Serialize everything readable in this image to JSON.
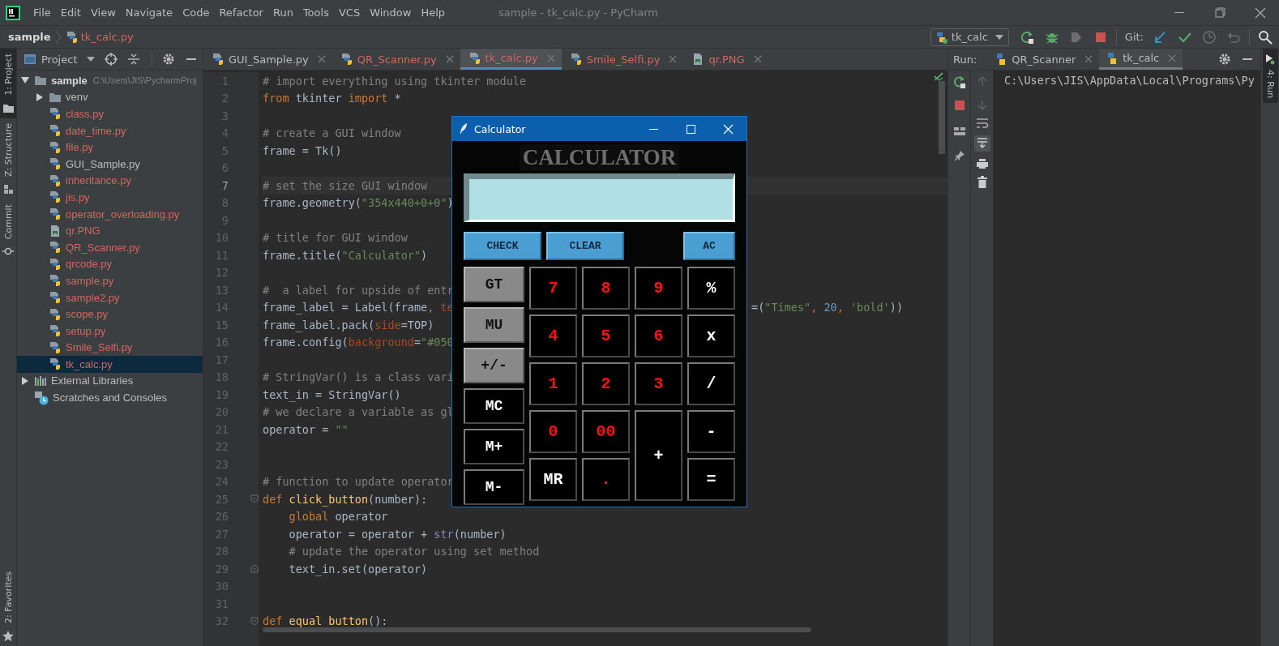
{
  "menu_bar": {
    "items": [
      "File",
      "Edit",
      "View",
      "Navigate",
      "Code",
      "Refactor",
      "Run",
      "Tools",
      "VCS",
      "Window",
      "Help"
    ],
    "title": "sample - tk_calc.py - PyCharm"
  },
  "navigation_bar": {
    "breadcrumbs": [
      {
        "label": "sample",
        "kind": "folder",
        "color": "#d8d8d8"
      },
      {
        "label": "tk_calc.py",
        "kind": "python",
        "color": "#d2665f"
      }
    ],
    "run_config": "tk_calc",
    "git_label": "Git:"
  },
  "left_stripe": {
    "tabs": [
      {
        "label": "1: Project",
        "kind": "project",
        "selected": true
      },
      {
        "label": "Z: Structure",
        "kind": "structure",
        "selected": false
      },
      {
        "label": "Commit",
        "kind": "commit",
        "selected": false
      }
    ],
    "bottom_tabs": [
      {
        "label": "2: Favorites",
        "kind": "favorites",
        "selected": false
      }
    ]
  },
  "project_panel": {
    "title": "Project",
    "tree": [
      {
        "label": "sample",
        "path": "C:\\Users\\JIS\\PycharmProj",
        "kind": "folder",
        "color": "#d8d8d8",
        "expanded": true,
        "selected": false,
        "children": [
          {
            "label": "venv",
            "kind": "folder",
            "color": "#bbbbbb",
            "expanded": false,
            "selected": false
          },
          {
            "label": "class.py",
            "kind": "python",
            "color": "#d2665f",
            "selected": false
          },
          {
            "label": "date_time.py",
            "kind": "python",
            "color": "#d2665f",
            "selected": false
          },
          {
            "label": "file.py",
            "kind": "python",
            "color": "#d2665f",
            "selected": false
          },
          {
            "label": "GUI_Sample.py",
            "kind": "python",
            "color": "#bbbbbb",
            "selected": false
          },
          {
            "label": "inheritance.py",
            "kind": "python",
            "color": "#d2665f",
            "selected": false
          },
          {
            "label": "jis.py",
            "kind": "python",
            "color": "#d2665f",
            "selected": false
          },
          {
            "label": "operator_overloading.py",
            "kind": "python",
            "color": "#d2665f",
            "selected": false
          },
          {
            "label": "qr.PNG",
            "kind": "image",
            "color": "#d2665f",
            "selected": false
          },
          {
            "label": "QR_Scanner.py",
            "kind": "python",
            "color": "#d2665f",
            "selected": false
          },
          {
            "label": "qrcode.py",
            "kind": "python",
            "color": "#d2665f",
            "selected": false
          },
          {
            "label": "sample.py",
            "kind": "python",
            "color": "#d2665f",
            "selected": false
          },
          {
            "label": "sample2.py",
            "kind": "python",
            "color": "#d2665f",
            "selected": false
          },
          {
            "label": "scope.py",
            "kind": "python",
            "color": "#d2665f",
            "selected": false
          },
          {
            "label": "setup.py",
            "kind": "python",
            "color": "#d2665f",
            "selected": false
          },
          {
            "label": "Smile_Selfi.py",
            "kind": "python",
            "color": "#d2665f",
            "selected": false
          },
          {
            "label": "tk_calc.py",
            "kind": "python",
            "color": "#d2665f",
            "selected": true
          }
        ]
      },
      {
        "label": "External Libraries",
        "kind": "library",
        "color": "#bbbbbb",
        "expanded": false,
        "selected": false
      },
      {
        "label": "Scratches and Consoles",
        "kind": "scratch",
        "color": "#bbbbbb",
        "selected": false
      }
    ]
  },
  "editor": {
    "tabs": [
      {
        "label": "GUI_Sample.py",
        "kind": "python",
        "color": "#bbbbbb",
        "selected": false
      },
      {
        "label": "QR_Scanner.py",
        "kind": "python",
        "color": "#d2665f",
        "selected": false
      },
      {
        "label": "tk_calc.py",
        "kind": "python",
        "color": "#d2665f",
        "selected": true
      },
      {
        "label": "Smile_Selfi.py",
        "kind": "python",
        "color": "#d2665f",
        "selected": false
      },
      {
        "label": "qr.PNG",
        "kind": "image",
        "color": "#d2665f",
        "selected": false
      }
    ],
    "lines": [
      {
        "number": "1",
        "current": false,
        "left": [
          {
            "kind": "comment",
            "text": "# import everything using tkinter module"
          }
        ]
      },
      {
        "number": "2",
        "current": false,
        "left": [
          {
            "kind": "keyword",
            "text": "from"
          },
          {
            "kind": "plain",
            "text": " tkinter "
          },
          {
            "kind": "keyword",
            "text": "import"
          },
          {
            "kind": "plain",
            "text": " *"
          }
        ]
      },
      {
        "number": "3",
        "current": false
      },
      {
        "number": "4",
        "current": false,
        "left": [
          {
            "kind": "comment",
            "text": "# create a GUI window"
          }
        ]
      },
      {
        "number": "5",
        "current": false,
        "left": [
          {
            "kind": "plain",
            "text": "frame = Tk()"
          }
        ]
      },
      {
        "number": "6",
        "current": false
      },
      {
        "number": "7",
        "current": true,
        "left": [
          {
            "kind": "comment",
            "text": "# set the size GUI window"
          }
        ]
      },
      {
        "number": "8",
        "current": false,
        "left": [
          {
            "kind": "plain",
            "text": "frame.geometry("
          },
          {
            "kind": "string",
            "text": "\"354x440+0+0\""
          },
          {
            "kind": "plain",
            "text": ")"
          }
        ]
      },
      {
        "number": "9",
        "current": false
      },
      {
        "number": "10",
        "current": false,
        "left": [
          {
            "kind": "comment",
            "text": "# title for GUI window"
          }
        ]
      },
      {
        "number": "11",
        "current": false,
        "left": [
          {
            "kind": "plain",
            "text": "frame.title("
          },
          {
            "kind": "string",
            "text": "\"Calculator\""
          },
          {
            "kind": "plain",
            "text": ")"
          }
        ]
      },
      {
        "number": "12",
        "current": false
      },
      {
        "number": "13",
        "current": false,
        "left": [
          {
            "kind": "comment",
            "text": "#  a label for upside of entr"
          }
        ]
      },
      {
        "number": "14",
        "current": false,
        "left": [
          {
            "kind": "plain",
            "text": "frame_label = Label(frame"
          },
          {
            "kind": "keyword",
            "text": ", "
          },
          {
            "kind": "kwarg",
            "text": "te"
          }
        ],
        "right": [
          {
            "kind": "plain",
            "text": "=("
          },
          {
            "kind": "string",
            "text": "\"Times\""
          },
          {
            "kind": "keyword",
            "text": ", "
          },
          {
            "kind": "number",
            "text": "20"
          },
          {
            "kind": "keyword",
            "text": ", "
          },
          {
            "kind": "string",
            "text": "'bold'"
          },
          {
            "kind": "plain",
            "text": "))"
          }
        ]
      },
      {
        "number": "15",
        "current": false,
        "left": [
          {
            "kind": "plain",
            "text": "frame_label.pack("
          },
          {
            "kind": "kwarg",
            "text": "side"
          },
          {
            "kind": "plain",
            "text": "=TOP)"
          }
        ]
      },
      {
        "number": "16",
        "current": false,
        "left": [
          {
            "kind": "plain",
            "text": "frame.config("
          },
          {
            "kind": "kwarg",
            "text": "background"
          },
          {
            "kind": "plain",
            "text": "="
          },
          {
            "kind": "string",
            "text": "\"#050"
          }
        ]
      },
      {
        "number": "17",
        "current": false
      },
      {
        "number": "18",
        "current": false,
        "left": [
          {
            "kind": "comment",
            "text": "# StringVar() is a class vari"
          }
        ]
      },
      {
        "number": "19",
        "current": false,
        "left": [
          {
            "kind": "plain",
            "text": "text_in = StringVar()"
          }
        ]
      },
      {
        "number": "20",
        "current": false,
        "left": [
          {
            "kind": "comment",
            "text": "# we declare a variable as gl"
          }
        ]
      },
      {
        "number": "21",
        "current": false,
        "left": [
          {
            "kind": "plain",
            "text": "operator = "
          },
          {
            "kind": "string",
            "text": "\"\""
          }
        ]
      },
      {
        "number": "22",
        "current": false
      },
      {
        "number": "23",
        "current": false
      },
      {
        "number": "24",
        "current": false,
        "left": [
          {
            "kind": "comment",
            "text": "# function to update operator"
          }
        ]
      },
      {
        "number": "25",
        "current": false,
        "fold_open": true,
        "left": [
          {
            "kind": "keyword",
            "text": "def "
          },
          {
            "kind": "function",
            "text": "click_button"
          },
          {
            "kind": "plain",
            "text": "(number):"
          }
        ]
      },
      {
        "number": "26",
        "current": false,
        "left": [
          {
            "kind": "keyword",
            "text": "    global"
          },
          {
            "kind": "plain",
            "text": " operator"
          }
        ]
      },
      {
        "number": "27",
        "current": false,
        "left": [
          {
            "kind": "plain",
            "text": "    operator = operator + "
          },
          {
            "kind": "builtin",
            "text": "str"
          },
          {
            "kind": "plain",
            "text": "(number)"
          }
        ]
      },
      {
        "number": "28",
        "current": false,
        "left": [
          {
            "kind": "comment",
            "text": "    # update the operator using set method"
          }
        ]
      },
      {
        "number": "29",
        "current": false,
        "fold_close": true,
        "left": [
          {
            "kind": "plain",
            "text": "    text_in.set(operator)"
          }
        ]
      },
      {
        "number": "30",
        "current": false
      },
      {
        "number": "31",
        "current": false
      },
      {
        "number": "32",
        "current": false,
        "fold_open": true,
        "left": [
          {
            "kind": "keyword",
            "text": "def "
          },
          {
            "kind": "function",
            "text": "equal_button"
          },
          {
            "kind": "plain",
            "text": "():"
          }
        ]
      }
    ]
  },
  "calculator": {
    "title": "Calculator",
    "heading": "CALCULATOR",
    "top_buttons": [
      {
        "label": "CHECK"
      },
      {
        "label": "CLEAR"
      },
      {
        "label": "AC"
      }
    ],
    "side_buttons": [
      {
        "label": "GT",
        "kind": "function"
      },
      {
        "label": "MU",
        "kind": "function"
      },
      {
        "label": "+/-",
        "kind": "function"
      },
      {
        "label": "MC",
        "kind": "memory"
      },
      {
        "label": "M+",
        "kind": "memory"
      },
      {
        "label": "M-",
        "kind": "memory"
      }
    ],
    "keypad": [
      {
        "label": "7",
        "kind": "digit",
        "tall": false
      },
      {
        "label": "4",
        "kind": "digit",
        "tall": false
      },
      {
        "label": "1",
        "kind": "digit",
        "tall": false
      },
      {
        "label": "0",
        "kind": "digit",
        "tall": false
      },
      {
        "label": "MR",
        "kind": "memory",
        "tall": false
      },
      {
        "label": "8",
        "kind": "digit",
        "tall": false
      },
      {
        "label": "5",
        "kind": "digit",
        "tall": false
      },
      {
        "label": "2",
        "kind": "digit",
        "tall": false
      },
      {
        "label": "00",
        "kind": "digit",
        "tall": false
      },
      {
        "label": ".",
        "kind": "digit",
        "tall": false
      },
      {
        "label": "9",
        "kind": "digit",
        "tall": false
      },
      {
        "label": "6",
        "kind": "digit",
        "tall": false
      },
      {
        "label": "3",
        "kind": "digit",
        "tall": false
      },
      {
        "label": "+",
        "kind": "operator",
        "tall": true
      },
      {
        "label": "%",
        "kind": "operator",
        "tall": false
      },
      {
        "label": "x",
        "kind": "operator",
        "tall": false
      },
      {
        "label": "/",
        "kind": "operator",
        "tall": false
      },
      {
        "label": "-",
        "kind": "operator",
        "tall": false
      },
      {
        "label": "=",
        "kind": "operator",
        "tall": false
      }
    ]
  },
  "run_panel": {
    "label": "Run:",
    "tabs": [
      {
        "label": "QR_Scanner",
        "selected": false
      },
      {
        "label": "tk_calc",
        "selected": true
      }
    ],
    "output": [
      "C:\\Users\\JIS\\AppData\\Local\\Programs\\Py"
    ]
  },
  "right_stripe": {
    "tabs": [
      {
        "label": "4: Run",
        "selected": true
      }
    ]
  }
}
